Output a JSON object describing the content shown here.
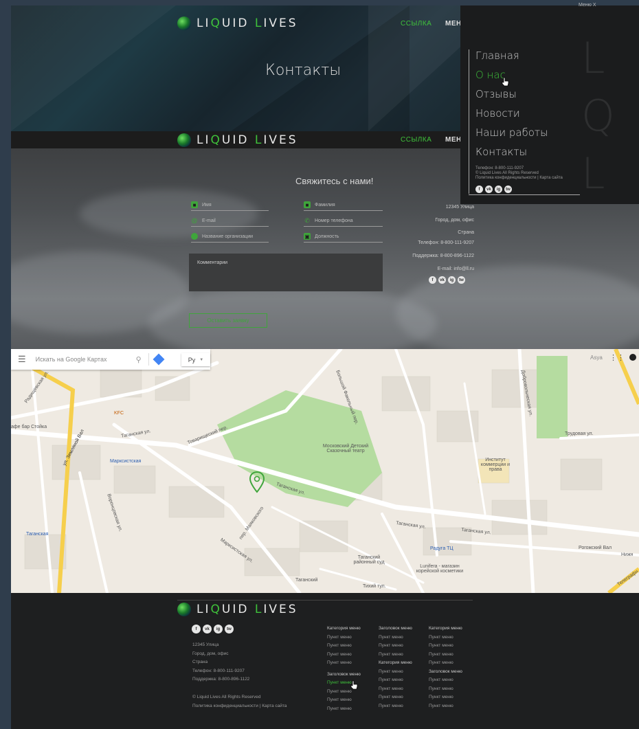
{
  "brand": {
    "name_prefix": "LI",
    "name_q": "Q",
    "name_mid": "UID ",
    "name_l": "L",
    "name_suffix": "IVES"
  },
  "nav": {
    "link": "ССЫЛКА",
    "menu": "МЕНЮ"
  },
  "hero": {
    "title": "Контакты"
  },
  "contact": {
    "title": "Свяжитесь с нами!",
    "fields": {
      "name": "Имя",
      "surname": "Фамилия",
      "email": "E-mail",
      "phone": "Номер телефона",
      "org": "Название организации",
      "position": "Должность"
    },
    "comment_placeholder": "Комментарии",
    "send_label": "Оставить заявку",
    "address": {
      "street": "12345 Улица",
      "city": "Город, дом, офис",
      "country": "Страна",
      "phone": "Телефон: 8-800-111-9207",
      "support": "Поддержка: 8-800-896-1122",
      "email": "E-mail: info@ll.ru"
    }
  },
  "socials": [
    "f",
    "vk",
    "ig",
    "tw"
  ],
  "map": {
    "search_placeholder": "Искать на Google Картах",
    "lang": "Ру",
    "account": "Asya",
    "labels": {
      "tovarishchesky": "Товарищеский пер.",
      "bolshoy_fakelny": "Большой Факельный пер.",
      "taganskaya1": "Таганская ул.",
      "taganskaya2": "Таганская ул.",
      "taganskaya3": "Таганская ул.",
      "taganskaya4": "Таганская ул.",
      "taganskaya_metro": "Таганская",
      "marksistskaya": "Марксистская",
      "marksistskaya_ul": "Марксистская ул.",
      "theatre": "Московский Детский Сказочный театр",
      "institute": "Институт коммерции и права",
      "raduga": "Радуга ТЦ",
      "court": "Таганский районный суд",
      "lunifera": "Lunifera - магазин корейской косметики",
      "kfc": "KFC",
      "cafe": "афе бар Стойка",
      "zemlyanoy": "ул. Земляной Вал",
      "radishchevskaya": "Радищевская ул.",
      "tikhy": "Тихий туп.",
      "taganskiy": "Таганский",
      "dobrovolcheskaya": "Добровольческая ул.",
      "trudovaya": "Трудовая ул.",
      "mayakovskogo": "пер. Маяковского",
      "voroncovskaya": "Воронцовская ул.",
      "rogozhsky": "Рогожский Вал",
      "nizhnyaya": "Нижн",
      "telegraph": "Телеграфн"
    }
  },
  "footer": {
    "address": [
      "12345 Улица",
      "Город, дом, офис",
      "Страна",
      "Телефон: 8-800-111-9207",
      "Поддержка: 8-800-896-1122"
    ],
    "copyright": "© Liquid Lives All Rights Reserved",
    "policy": "Политика конфиденциальности | Карта сайта",
    "col1": [
      "Категория меню",
      "Пункт меню",
      "Пункт меню",
      "Пункт меню",
      "Пункт меню",
      "",
      "Заголовок меню",
      "Пункт меню",
      "Пункт меню",
      "Пункт меню",
      "Пункт меню"
    ],
    "col2": [
      "Заголовок меню",
      "Пункт меню",
      "Пункт меню",
      "Пункт меню",
      "Категория меню",
      "Пункт меню",
      "Пункт меню",
      "Пункт меню",
      "Пункт меню",
      "Пункт меню"
    ],
    "col3": [
      "Категория меню",
      "Пункт меню",
      "Пункт меню",
      "Пункт меню",
      "Пункт меню",
      "Заголовок меню",
      "Пункт меню",
      "Пункт меню",
      "Пункт меню",
      "Пункт меню"
    ]
  },
  "overlay": {
    "close": "Меню X",
    "items": [
      "Главная",
      "О нас",
      "Отзывы",
      "Новости",
      "Наши работы",
      "Контакты"
    ],
    "active_index": 1,
    "info": [
      "Телефон: 8-800-111-9207",
      "© Liquid Lives All Rights Reserved",
      "Политика конфиденциальности | Карта сайта"
    ],
    "big_letters": [
      "L",
      "Q",
      "L"
    ]
  },
  "colors": {
    "accent": "#3fc23b",
    "dark": "#1e1f20"
  }
}
